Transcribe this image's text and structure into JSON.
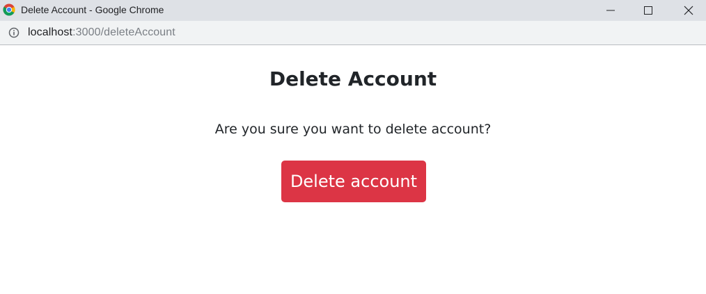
{
  "window": {
    "title": "Delete Account - Google Chrome",
    "icons": {
      "app": "chrome-icon",
      "minimize": "minimize-icon",
      "maximize": "maximize-icon",
      "close": "close-icon"
    }
  },
  "addressbar": {
    "icon": "info-icon",
    "url_host": "localhost",
    "url_path": ":3000/deleteAccount"
  },
  "page": {
    "title": "Delete Account",
    "prompt": "Are you sure you want to delete account?",
    "delete_button_label": "Delete account"
  },
  "colors": {
    "titlebar_bg": "#dee1e6",
    "addressbar_bg": "#f1f3f4",
    "danger": "#dc3545",
    "text": "#212529"
  }
}
